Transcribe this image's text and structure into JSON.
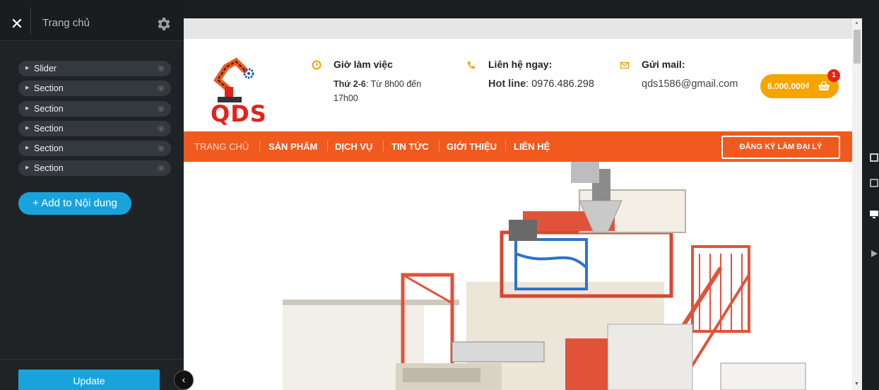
{
  "editor": {
    "close_icon": "close-icon",
    "panel_title": "Trang chủ",
    "settings_icon": "gear-icon",
    "tree": [
      {
        "label": "Slider"
      },
      {
        "label": "Section"
      },
      {
        "label": "Section"
      },
      {
        "label": "Section"
      },
      {
        "label": "Section"
      },
      {
        "label": "Section"
      }
    ],
    "add_button": "+ Add to Nội dung",
    "update_button": "Update",
    "collapse_icon": "chevron-left-icon"
  },
  "site": {
    "logo_text": "QDS",
    "hours": {
      "title": "Giờ làm việc",
      "days": "Thứ 2-6",
      "detail": ": Từ 8h00 đến",
      "detail2": "17h00"
    },
    "contact": {
      "title": "Liên hệ ngay:",
      "hotline_label": "Hot line",
      "hotline_value": ": 0976.486.298"
    },
    "mail": {
      "title": "Gửi mail:",
      "email": "qds1586@gmail.com"
    },
    "cart": {
      "total": "6.000.000₫",
      "count": "1"
    },
    "nav": [
      "TRANG CHỦ",
      "SẢN PHẨM",
      "DỊCH VỤ",
      "TIN TỨC",
      "GIỚI THIỆU",
      "LIÊN HỆ"
    ],
    "cta": "ĐĂNG KÝ LÀM ĐẠI LÝ"
  },
  "colors": {
    "accent_blue": "#19a3dd",
    "nav_orange": "#f05a1e",
    "cart_yellow": "#f5a400",
    "brand_red": "#e2231a"
  }
}
